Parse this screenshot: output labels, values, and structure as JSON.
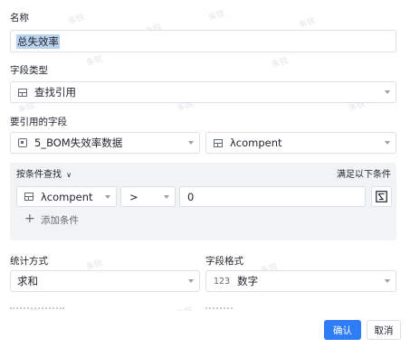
{
  "watermark": "朱锐",
  "name_field": {
    "label": "名称",
    "value": "总失效率"
  },
  "field_type": {
    "label": "字段类型",
    "value": "查找引用"
  },
  "referenced_field": {
    "label": "要引用的字段",
    "table_value": "5_BOM失效率数据",
    "field_value": "λcompent"
  },
  "conditions": {
    "mode_label": "按条件查找",
    "match_label": "满足以下条件",
    "row": {
      "field": "λcompent",
      "operator": ">",
      "value": "0"
    },
    "add_label": "添加条件"
  },
  "statistics": {
    "label": "统计方式",
    "value": "求和"
  },
  "field_format": {
    "label": "字段格式",
    "icon_text": "123",
    "value": "数字"
  },
  "footer": {
    "confirm_label": "确认",
    "cancel_label": "取消"
  }
}
